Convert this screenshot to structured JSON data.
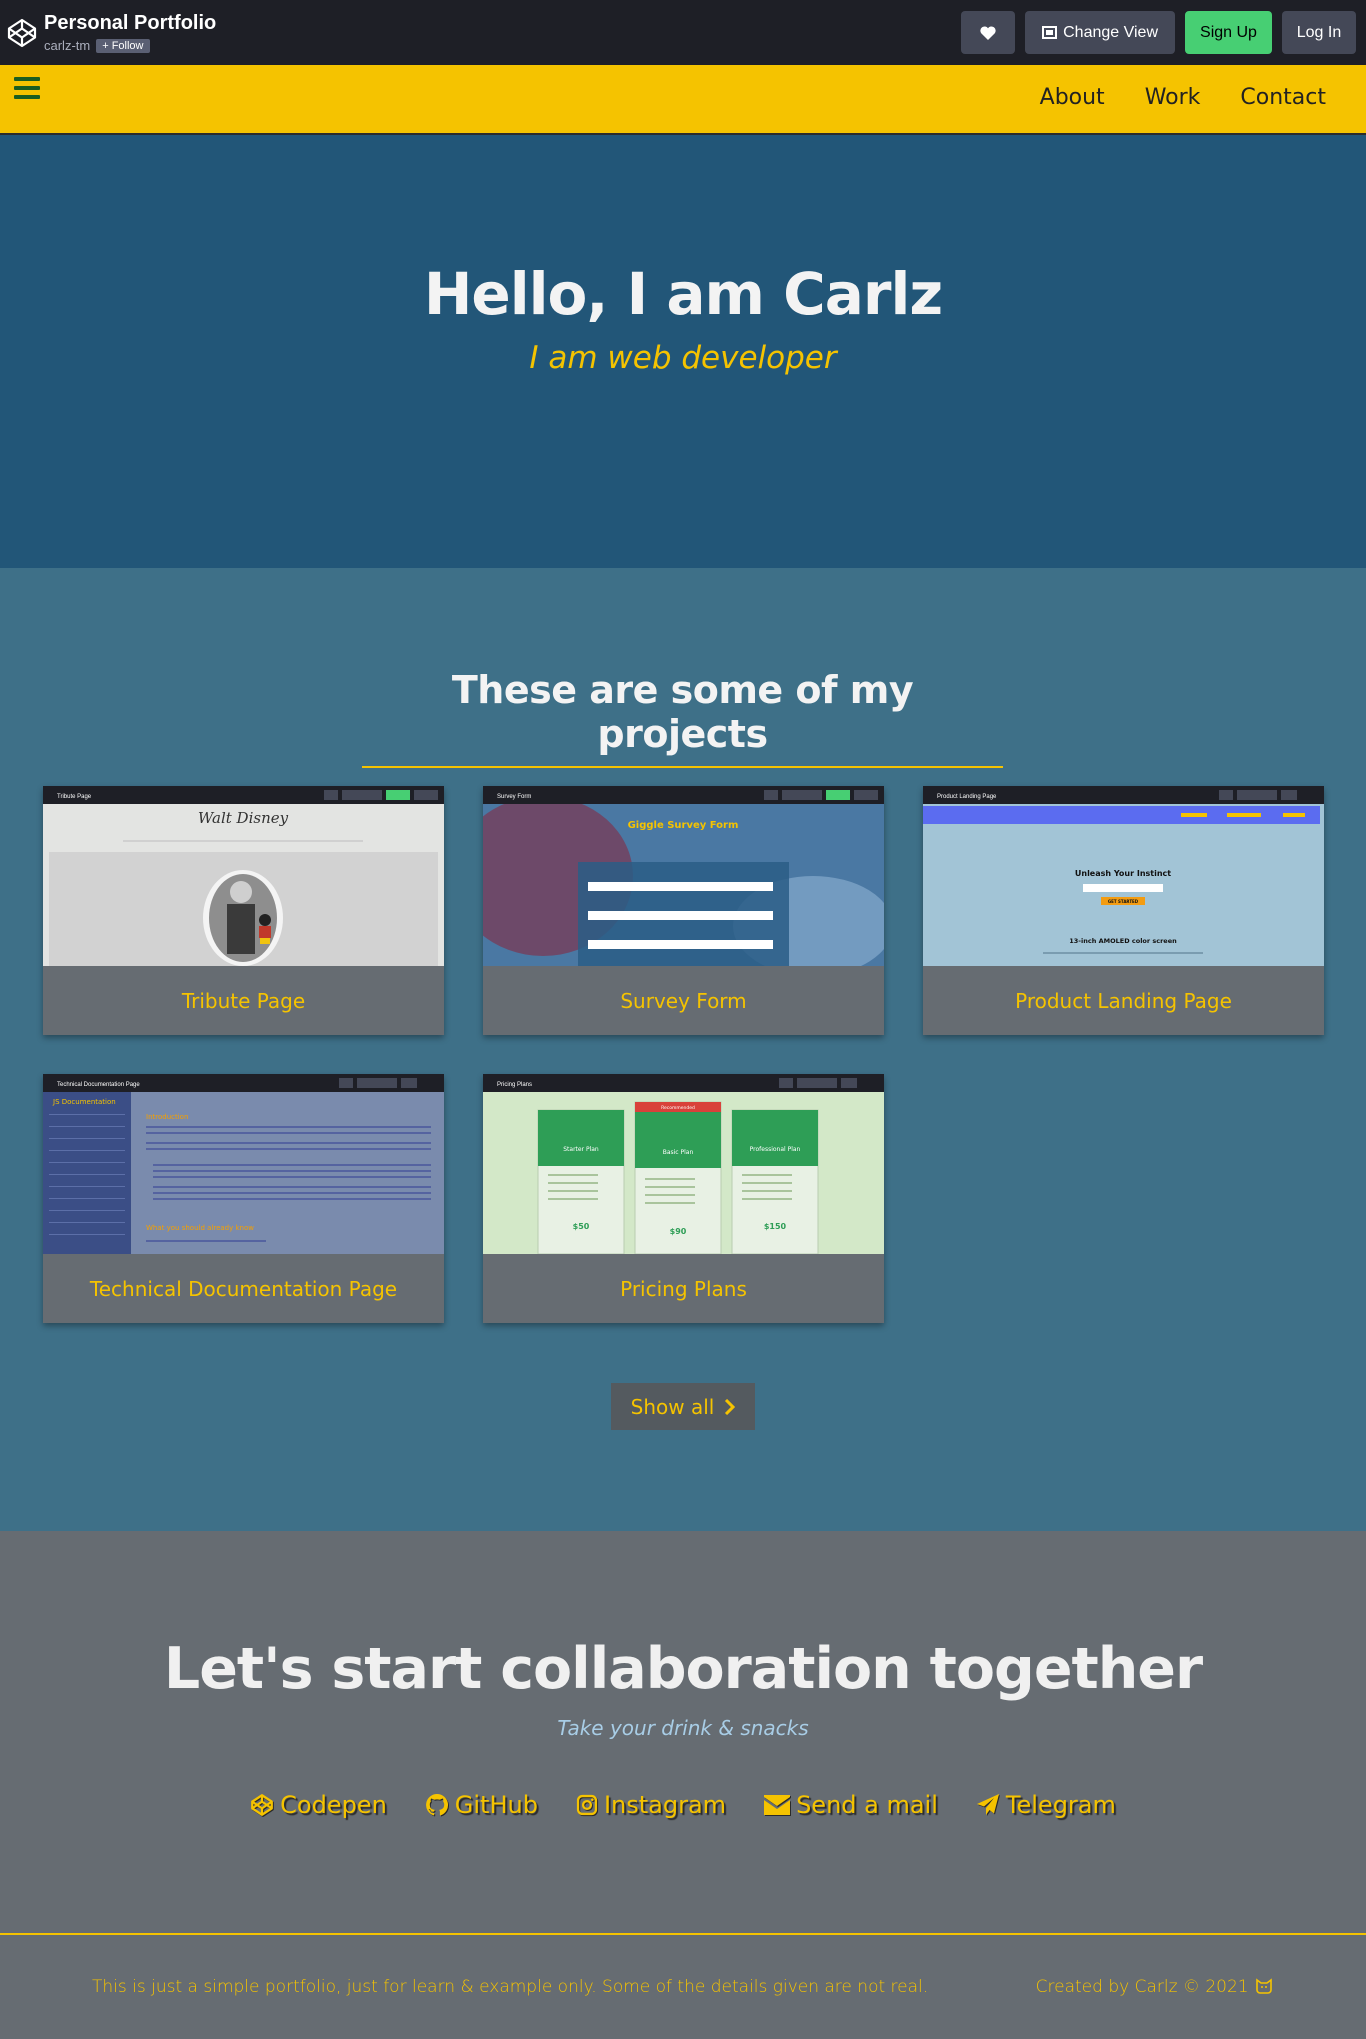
{
  "codepen": {
    "title": "Personal Portfolio",
    "user": "carlz-tm",
    "follow_label": "+ Follow",
    "change_view_label": "Change View",
    "signup_label": "Sign Up",
    "login_label": "Log In"
  },
  "nav": {
    "links": [
      "About",
      "Work",
      "Contact"
    ]
  },
  "hero": {
    "title": "Hello, I am Carlz",
    "subtitle": "I am web developer"
  },
  "projects": {
    "heading": "These are some of my projects",
    "items": [
      {
        "title": "Tribute Page"
      },
      {
        "title": "Survey Form"
      },
      {
        "title": "Product Landing Page"
      },
      {
        "title": "Technical Documentation Page"
      },
      {
        "title": "Pricing Plans"
      }
    ],
    "show_all_label": "Show all"
  },
  "thumbs": {
    "tribute": {
      "bar": "Tribute Page",
      "heading": "Walt Disney"
    },
    "survey": {
      "bar": "Survey Form",
      "heading": "Giggle Survey Form"
    },
    "landing": {
      "bar": "Product Landing Page",
      "heading": "Unleash Your Instinct",
      "cta": "GET STARTED",
      "feature": "13-inch AMOLED color screen"
    },
    "docs": {
      "bar": "Technical Documentation Page",
      "side_title": "JS Documentation",
      "h1": "Introduction",
      "h2": "What you should already know"
    },
    "pricing": {
      "bar": "Pricing Plans",
      "recommended": "Recommended",
      "plans": [
        "Starter Plan",
        "Basic Plan",
        "Professional Plan"
      ],
      "prices": [
        "$50",
        "$90",
        "$150"
      ]
    }
  },
  "collab": {
    "title": "Let's start collaboration together",
    "subtitle": "Take your drink & snacks",
    "links": [
      "Codepen",
      "GitHub",
      "Instagram",
      "Send a mail",
      "Telegram"
    ]
  },
  "footer": {
    "note": "This is just a simple portfolio, just for learn & example only. Some of the details given are not real.",
    "credit": "Created by Carlz © 2021"
  },
  "colors": {
    "accent": "#f5c300",
    "hero_bg": "#225678",
    "projects_bg": "#3e7088",
    "footer_bg": "#666c72",
    "codepen_bar": "#1e1f26",
    "signup_green": "#47cf73"
  }
}
